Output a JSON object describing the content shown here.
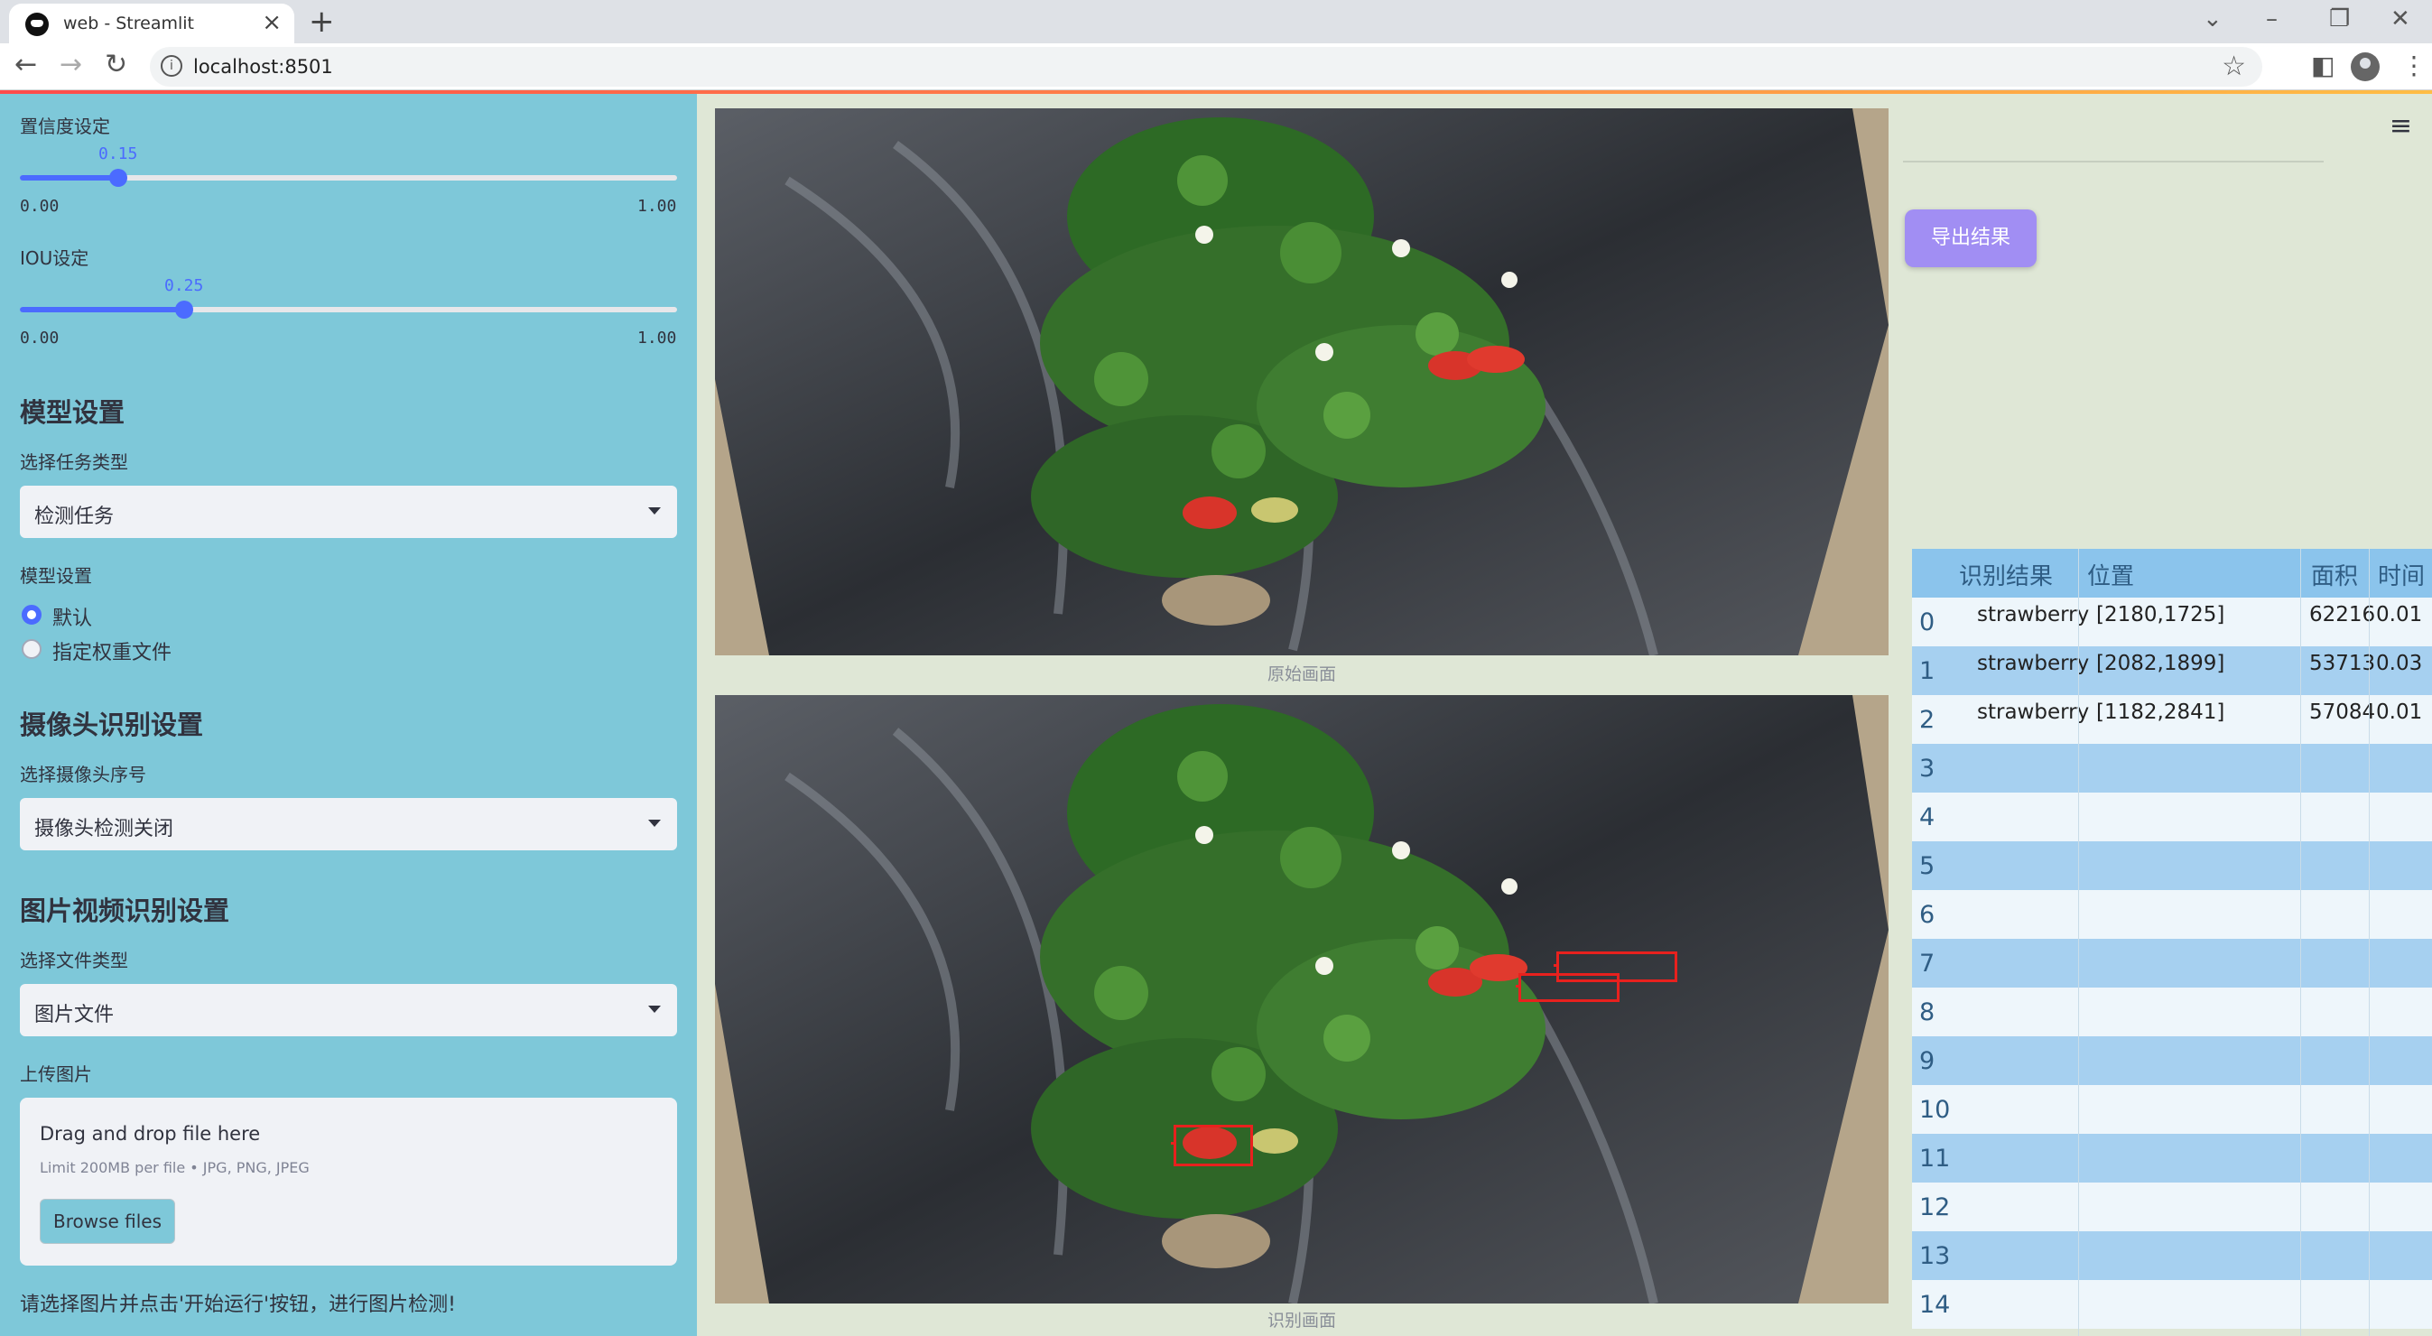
{
  "browser": {
    "tab_title": "web - Streamlit",
    "url": "localhost:8501",
    "tab_close": "×",
    "new_tab": "+"
  },
  "sidebar": {
    "confidence": {
      "label": "置信度设定",
      "value": "0.15",
      "min": "0.00",
      "max": "1.00",
      "fraction": 0.15
    },
    "iou": {
      "label": "IOU设定",
      "value": "0.25",
      "min": "0.00",
      "max": "1.00",
      "fraction": 0.25
    },
    "model_section": {
      "header": "模型设置",
      "task_label": "选择任务类型",
      "task_value": "检测任务",
      "model_label": "模型设置",
      "options": [
        "默认",
        "指定权重文件"
      ],
      "selected_index": 0
    },
    "camera_section": {
      "header": "摄像头识别设置",
      "camera_label": "选择摄像头序号",
      "camera_value": "摄像头检测关闭"
    },
    "media_section": {
      "header": "图片视频识别设置",
      "file_type_label": "选择文件类型",
      "file_type_value": "图片文件",
      "upload_label": "上传图片",
      "dropzone_title": "Drag and drop file here",
      "dropzone_limit": "Limit 200MB per file • JPG, PNG, JPEG",
      "browse_button": "Browse files"
    },
    "hint": "请选择图片并点击'开始运行'按钮，进行图片检测!"
  },
  "main": {
    "original_caption": "原始画面",
    "detected_caption": "识别画面",
    "export_button": "导出结果",
    "menu_icon": "hamburger-menu-icon"
  },
  "results_table": {
    "headers": [
      "识别结果",
      "位置",
      "面积",
      "时间"
    ],
    "rows": [
      {
        "index": "0",
        "label": "strawberry",
        "position": "[2180,1725]",
        "area": "62216",
        "time": "0.01"
      },
      {
        "index": "1",
        "label": "strawberry",
        "position": "[2082,1899]",
        "area": "53713",
        "time": "0.03"
      },
      {
        "index": "2",
        "label": "strawberry",
        "position": "[1182,2841]",
        "area": "57084",
        "time": "0.01"
      },
      {
        "index": "3"
      },
      {
        "index": "4"
      },
      {
        "index": "5"
      },
      {
        "index": "6"
      },
      {
        "index": "7"
      },
      {
        "index": "8"
      },
      {
        "index": "9"
      },
      {
        "index": "10"
      },
      {
        "index": "11"
      },
      {
        "index": "12"
      },
      {
        "index": "13"
      },
      {
        "index": "14"
      }
    ]
  },
  "colors": {
    "sidebar_bg": "#7ec8d9",
    "accent": "#4b6bff",
    "export_button": "#a18ef3",
    "detection_box": "#e8211e"
  }
}
